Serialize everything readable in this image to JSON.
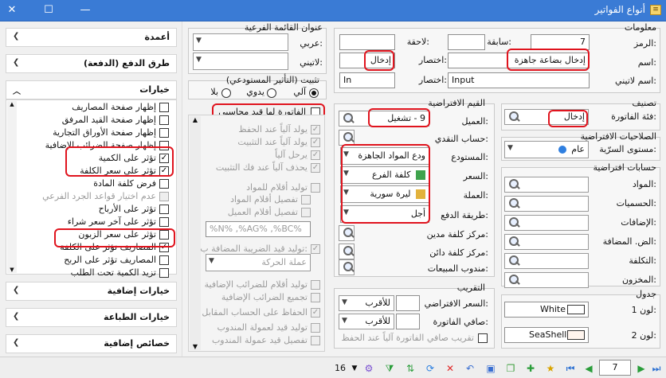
{
  "window": {
    "title": "أنواع الفواتير",
    "min": "—",
    "max": "☐",
    "close": "✕"
  },
  "info": {
    "section": "معلومات",
    "code_label": "الرمز:",
    "code_value": "7",
    "prev_label": "سابقة:",
    "next_label": "لاحقة:",
    "name_label": "اسم:",
    "name_value": "إدخال بضاعة جاهزة",
    "abbr_label": "اختصار:",
    "abbr_value": "إدخال",
    "latin_label": "اسم لاتيني:",
    "latin_value": "Input",
    "latin_abbr_label": "اختصار:",
    "latin_abbr_value": "In"
  },
  "subtitle": {
    "section": "عنوان القائمة الفرعية",
    "arabic_label": "عربي:",
    "latin_label": "لاتيني:"
  },
  "classify": {
    "section": "تصنيف",
    "cat_label": "فئة الفاتورة:",
    "cat_value": "إدخال"
  },
  "perms": {
    "section": "الصلاحيات الافتراضية",
    "sec_label": "مستوى السرّية:",
    "sec_value": "عام"
  },
  "accounts": {
    "section": "حسابات افتراضية",
    "items": [
      "المواد:",
      "الحسميات:",
      "الإضافات:",
      "الض. المضافة:",
      "التكلفة:",
      "المخزون:"
    ]
  },
  "tables": {
    "section": "جدول",
    "color1_label": "لون 1:",
    "color1_value": "White",
    "color1_hex": "#ffffff",
    "color2_label": "لون 2:",
    "color2_value": "SeaShell",
    "color2_hex": "#fff5ee"
  },
  "defaults": {
    "section": "القيم الافتراضية",
    "customer_label": "العميل:",
    "customer_value": "9 - تشغيل",
    "cash_label": "حساب النقدي:",
    "store_label": "المستودع:",
    "store_value": "ودع المواد الجاهزة",
    "price_label": "السعر:",
    "price_value": "كلفة الفرع",
    "currency_label": "العملة:",
    "currency_value": "ليرة سورية",
    "pay_label": "طريقة الدفع:",
    "pay_value": "أجل",
    "debit_label": "مركز كلفة مدين:",
    "credit_label": "مركز كلفة دائن:",
    "rep_label": "مندوب المبيعات:"
  },
  "rounding": {
    "section": "التقريب",
    "def_price_label": "السعر الافتراضي:",
    "def_price_value": "للأقرب",
    "net_label": "صافي الفاتورة:",
    "net_value": "للأقرب",
    "auto_label": "تقريب صافي الفاتورة آلياً عند الحفظ"
  },
  "posting": {
    "section": "تثبيت (التأثير المستودعي)",
    "auto": "آلي",
    "manual": "يدوي",
    "none": "بلا",
    "has_entry": "الفاتورة لها قيد محاسبي"
  },
  "options": [
    {
      "label": "يولد آلياً عند الحفظ",
      "checked": true,
      "enabled": false
    },
    {
      "label": "يولد آلياً عند التثبيت",
      "checked": true,
      "enabled": false
    },
    {
      "label": "يرحل آلياً",
      "checked": true,
      "enabled": false
    },
    {
      "label": "يحذف آلياً عند فك التثبيت",
      "checked": true,
      "enabled": false
    },
    {
      "label": "توليد أقلام للمواد",
      "checked": false,
      "enabled": false
    },
    {
      "label": "تفصيل أقلام المواد",
      "checked": false,
      "enabled": false
    },
    {
      "label": "تفصيل أقلام العميل",
      "checked": false,
      "enabled": false
    },
    {
      "label": "%N% ,%AG% ,%BC%",
      "checked": false,
      "enabled": false
    },
    {
      "label": "توليد قيد الضريبة المضافة ب:",
      "checked": true,
      "enabled": false
    },
    {
      "label": "عملة الحركة",
      "checked": false,
      "enabled": false
    },
    {
      "label": "توليد أقلام للضرائب الإضافية",
      "checked": false,
      "enabled": false
    },
    {
      "label": "تجميع الضرائب الإضافية",
      "checked": false,
      "enabled": false
    },
    {
      "label": "الحفاظ على الحساب المقابل",
      "checked": true,
      "enabled": false
    },
    {
      "label": "توليد قيد لعمولة المندوب",
      "checked": false,
      "enabled": false
    },
    {
      "label": "تفصيل قيد عمولة المندوب",
      "checked": false,
      "enabled": false
    }
  ],
  "side": {
    "columns": "أعمدة",
    "payment": "طرق الدفع (الدفعة)",
    "options": "خيارات",
    "extra_options": "خيارات إضافية",
    "print_options": "خيارات الطباعة",
    "extra_props": "خصائص إضافية",
    "checks": [
      {
        "label": "إظهار صفحة المصاريف",
        "checked": false,
        "enabled": true
      },
      {
        "label": "إظهار صفحة القيد المرفق",
        "checked": false,
        "enabled": true
      },
      {
        "label": "إظهار صفحة الأوراق التجارية",
        "checked": false,
        "enabled": true
      },
      {
        "label": "إظهار صفحة الضرائب الإضافية",
        "checked": false,
        "enabled": true
      },
      {
        "label": "تؤثر على الكمية",
        "checked": true,
        "enabled": true
      },
      {
        "label": "تؤثر على سعر الكلفة",
        "checked": true,
        "enabled": true
      },
      {
        "label": "فرض كلفة المادة",
        "checked": false,
        "enabled": true
      },
      {
        "label": "عدم اختيار قواعد الجرد الفرعي",
        "checked": false,
        "enabled": false
      },
      {
        "label": "تؤثر على الأرباح",
        "checked": false,
        "enabled": true
      },
      {
        "label": "تؤثر على آخر سعر شراء",
        "checked": false,
        "enabled": true
      },
      {
        "label": "تؤثر على سعر الزبون",
        "checked": false,
        "enabled": true
      },
      {
        "label": "المصاريف تؤثر على الكلفة",
        "checked": true,
        "enabled": true
      },
      {
        "label": "المصاريف تؤثر على الربح",
        "checked": false,
        "enabled": true
      },
      {
        "label": "تزيد الكمية تحت الطلب",
        "checked": false,
        "enabled": true
      }
    ]
  },
  "footer": {
    "count": "16",
    "page": "7"
  }
}
